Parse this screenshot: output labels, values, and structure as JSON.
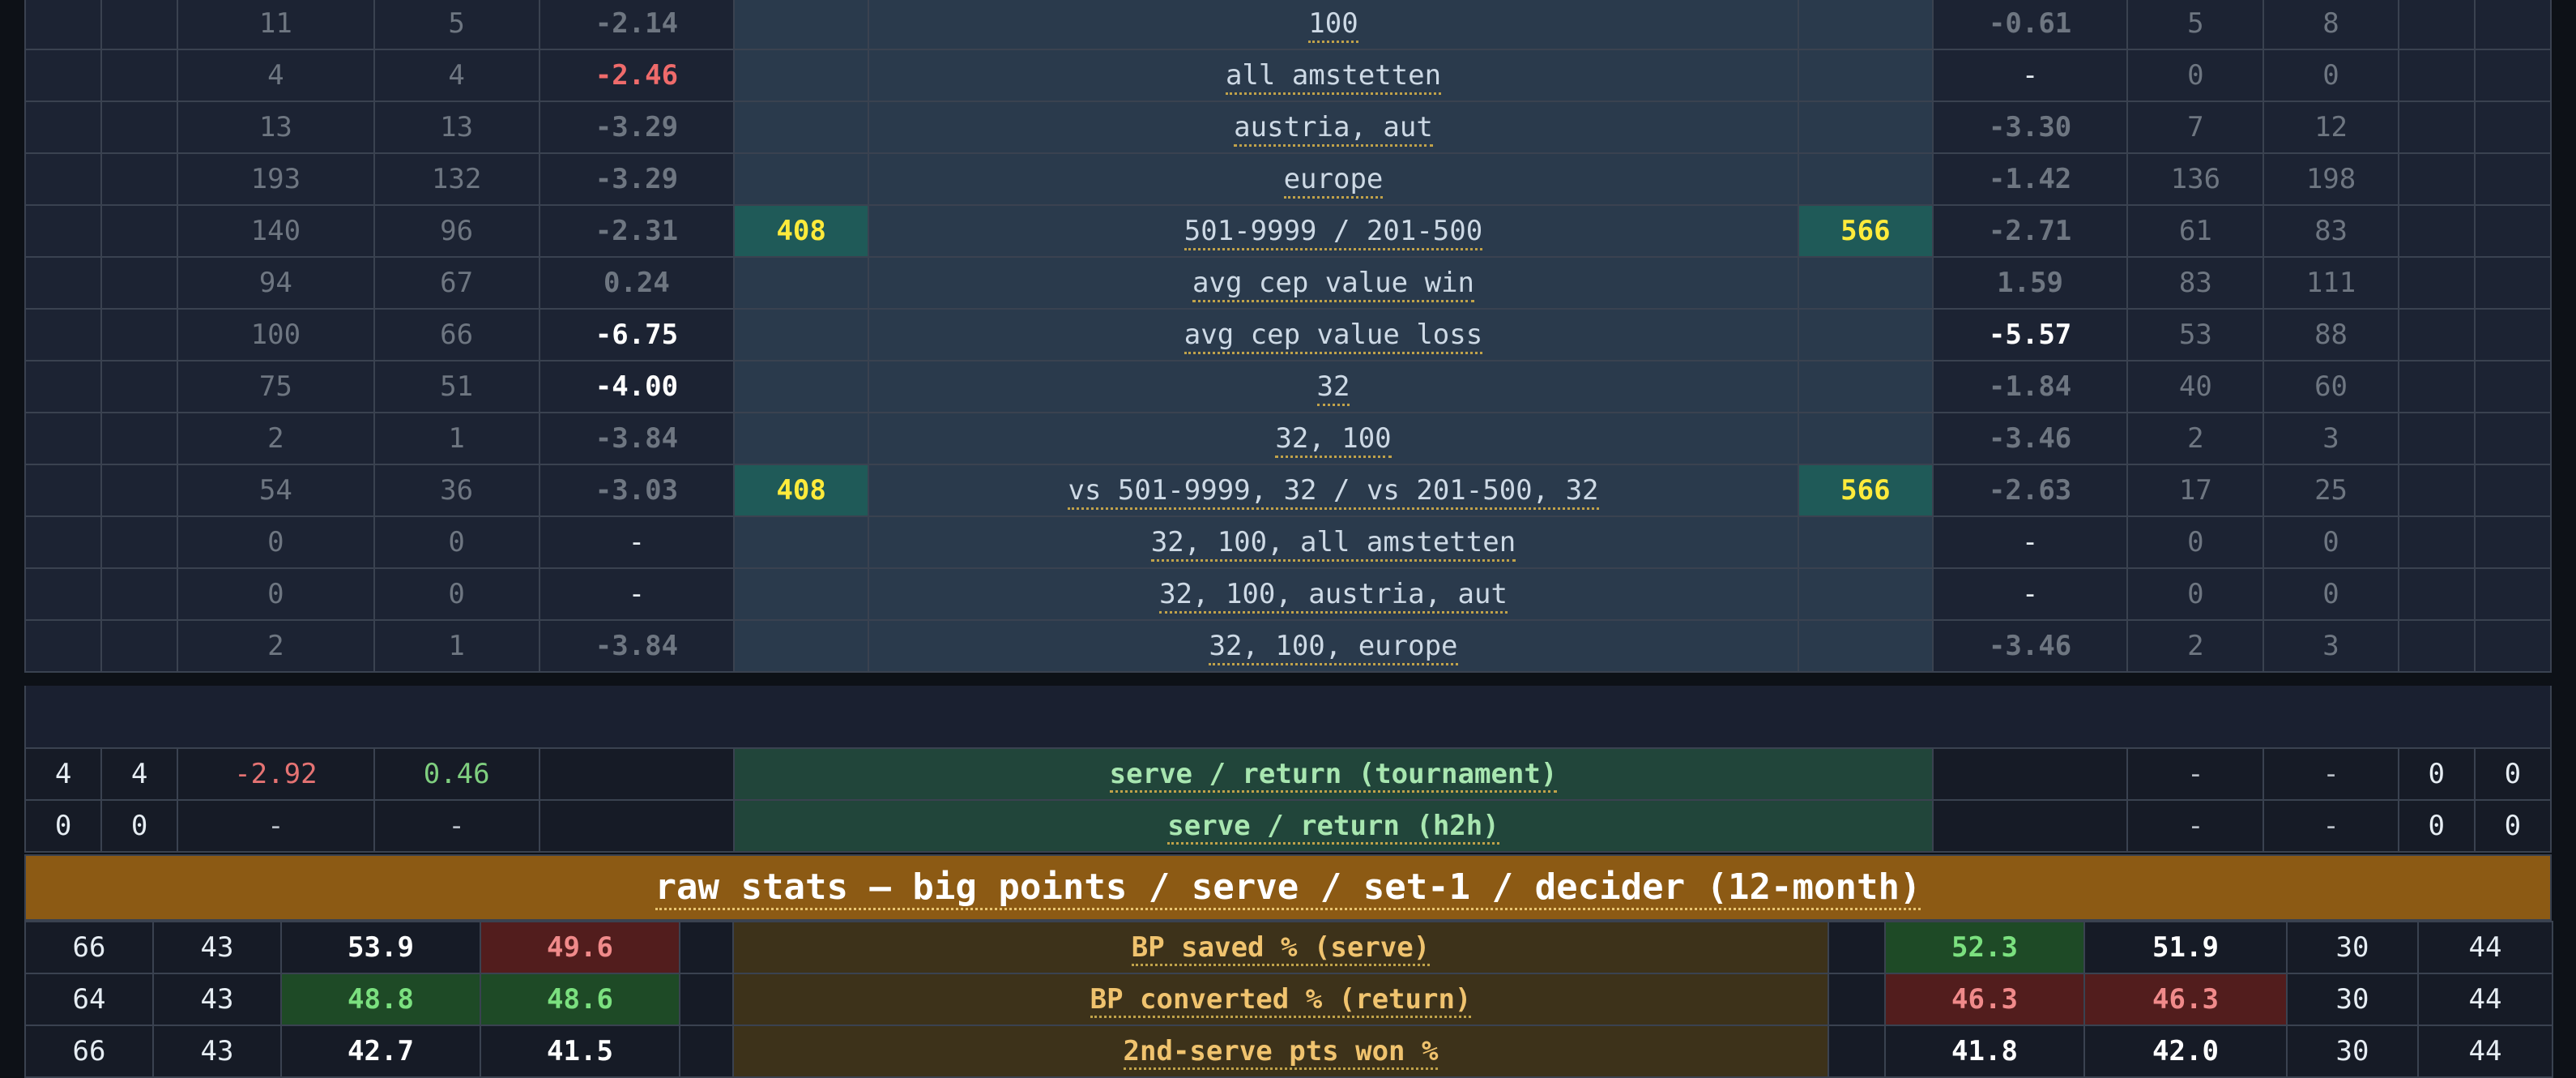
{
  "top_rows": [
    {
      "l1": "11",
      "l2": "5",
      "lv": "-2.14",
      "lc": "c2",
      "lr": "",
      "label": "100",
      "rr": "",
      "rv": "-0.61",
      "rc": "c1",
      "r1": "5",
      "r2": "8"
    },
    {
      "l1": "4",
      "l2": "4",
      "lv": "-2.46",
      "lc": "dashred",
      "lr": "",
      "label": "all amstetten",
      "rr": "",
      "rv": "-",
      "rc": "dash",
      "r1": "0",
      "r2": "0"
    },
    {
      "l1": "13",
      "l2": "13",
      "lv": "-3.29",
      "lc": "c4",
      "lr": "",
      "label": "austria, aut",
      "rr": "",
      "rv": "-3.30",
      "rc": "c4",
      "r1": "7",
      "r2": "12"
    },
    {
      "l1": "193",
      "l2": "132",
      "lv": "-3.29",
      "lc": "c4",
      "lr": "",
      "label": "europe",
      "rr": "",
      "rv": "-1.42",
      "rc": "c2",
      "r1": "136",
      "r2": "198"
    },
    {
      "l1": "140",
      "l2": "96",
      "lv": "-2.31",
      "lc": "c3",
      "lr": "408",
      "label": "501-9999 / 201-500",
      "rr": "566",
      "rv": "-2.71",
      "rc": "c3",
      "r1": "61",
      "r2": "83"
    },
    {
      "l1": "94",
      "l2": "67",
      "lv": "0.24",
      "lc": "g1",
      "lr": "",
      "label": "avg cep value win",
      "rr": "",
      "rv": "1.59",
      "rc": "g2",
      "r1": "83",
      "r2": "111"
    },
    {
      "l1": "100",
      "l2": "66",
      "lv": "-6.75",
      "lc": "c6",
      "lr": "",
      "label": "avg cep value loss",
      "rr": "",
      "rv": "-5.57",
      "rc": "c7",
      "r1": "53",
      "r2": "88"
    },
    {
      "l1": "75",
      "l2": "51",
      "lv": "-4.00",
      "lc": "c5",
      "lr": "",
      "label": "32",
      "rr": "",
      "rv": "-1.84",
      "rc": "c2",
      "r1": "40",
      "r2": "60"
    },
    {
      "l1": "2",
      "l2": "1",
      "lv": "-3.84",
      "lc": "c4",
      "lr": "",
      "label": "32, 100",
      "rr": "",
      "rv": "-3.46",
      "rc": "c4",
      "r1": "2",
      "r2": "3"
    },
    {
      "l1": "54",
      "l2": "36",
      "lv": "-3.03",
      "lc": "c4",
      "lr": "408",
      "label": "vs 501-9999, 32 / vs 201-500, 32",
      "rr": "566",
      "rv": "-2.63",
      "rc": "c3",
      "r1": "17",
      "r2": "25"
    },
    {
      "l1": "0",
      "l2": "0",
      "lv": "-",
      "lc": "dash",
      "lr": "",
      "label": "32, 100, all amstetten",
      "rr": "",
      "rv": "-",
      "rc": "dash",
      "r1": "0",
      "r2": "0"
    },
    {
      "l1": "0",
      "l2": "0",
      "lv": "-",
      "lc": "dash",
      "lr": "",
      "label": "32, 100, austria, aut",
      "rr": "",
      "rv": "-",
      "rc": "dash",
      "r1": "0",
      "r2": "0"
    },
    {
      "l1": "2",
      "l2": "1",
      "lv": "-3.84",
      "lc": "c4",
      "lr": "",
      "label": "32, 100, europe",
      "rr": "",
      "rv": "-3.46",
      "rc": "c4",
      "r1": "2",
      "r2": "3"
    }
  ],
  "serve_return": [
    {
      "a": "4",
      "b": "4",
      "c": "-2.92",
      "d": "0.46",
      "label": "serve / return (tournament)",
      "e": "-",
      "f": "-",
      "g": "0",
      "h": "0"
    },
    {
      "a": "0",
      "b": "0",
      "c": "-",
      "d": "-",
      "label": "serve / return (h2h)",
      "e": "-",
      "f": "-",
      "g": "0",
      "h": "0"
    }
  ],
  "band_title": "raw stats — big points / serve / set-1 / decider (12-month)",
  "raw_rows": [
    {
      "a": "66",
      "b": "43",
      "c": "53.9",
      "cc": "b",
      "d": "49.6",
      "dc": "rd",
      "label": "BP saved % (serve)",
      "e": "52.3",
      "ec": "gn",
      "f": "51.9",
      "fc": "b",
      "g": "30",
      "h": "44"
    },
    {
      "a": "64",
      "b": "43",
      "c": "48.8",
      "cc": "gn",
      "d": "48.6",
      "dc": "gn",
      "label": "BP converted % (return)",
      "e": "46.3",
      "ec": "rd",
      "f": "46.3",
      "fc": "rd",
      "g": "30",
      "h": "44"
    },
    {
      "a": "66",
      "b": "43",
      "c": "42.7",
      "cc": "b",
      "d": "41.5",
      "dc": "b",
      "label": "2nd-serve pts won %",
      "e": "41.8",
      "ec": "b",
      "f": "42.0",
      "fc": "b",
      "g": "30",
      "h": "44"
    }
  ]
}
